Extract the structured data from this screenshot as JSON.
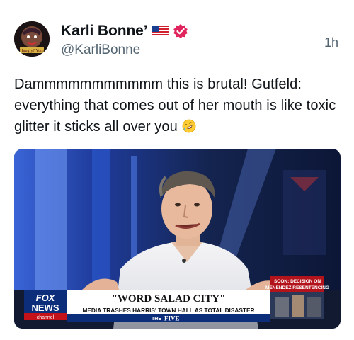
{
  "post": {
    "author": {
      "display_name": "Karli Bonne’",
      "handle": "@KarliBonne",
      "avatar_caption": "Hungry? Yum",
      "flag_icon": "us-flag-icon",
      "verified_icon": "verified-badge-icon",
      "verified_color": "#e0245e"
    },
    "timestamp": "1h",
    "text": "Dammmmmmmmmmm this is brutal! Gutfeld: everything that comes out of her mouth is like toxic glitter it sticks all over you",
    "text_emoji": "rolling-on-floor-laughing-emoji"
  },
  "media": {
    "type": "video-still",
    "network_logo": {
      "line1": "FOX",
      "line2": "NEWS",
      "line3": "channel"
    },
    "headline": "\"WORD SALAD CITY\"",
    "subheadline": "MEDIA TRASHES HARRIS' TOWN HALL AS TOTAL DISASTER",
    "show_name_prefix": "THE",
    "show_name": "FIVE",
    "promo": {
      "line1": "SOON: DECISION ON",
      "line2": "MENENDEZ RESENTENCING"
    }
  }
}
